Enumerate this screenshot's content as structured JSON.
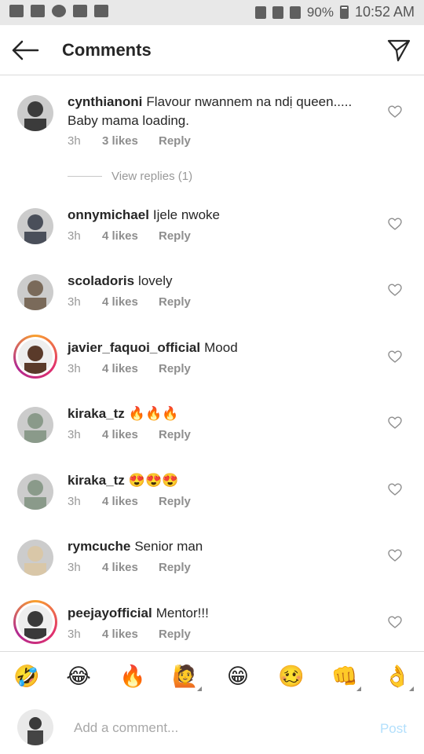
{
  "status_bar": {
    "battery": "90%",
    "time": "10:52 AM",
    "icons": [
      "gmail-icon",
      "message-icon",
      "whatsapp-icon",
      "gallery-icon",
      "email-icon",
      "alarm-icon",
      "wifi-icon",
      "signal-icon",
      "battery-icon"
    ]
  },
  "header": {
    "title": "Comments",
    "back_icon": "back-arrow-icon",
    "share_icon": "direct-send-icon"
  },
  "comments": [
    {
      "user": "cynthianoni",
      "text": "Flavour nwannem na ndị queen..... Baby mama loading.",
      "time": "3h",
      "likes": "3 likes",
      "reply": "Reply",
      "story_ring": false,
      "avatar_color": "#3b3b3b"
    },
    {
      "user": "onnymichael",
      "text": "Ijele nwoke",
      "time": "3h",
      "likes": "4 likes",
      "reply": "Reply",
      "story_ring": false,
      "avatar_color": "#4a4f5a"
    },
    {
      "user": "scoladoris",
      "text": "lovely",
      "time": "3h",
      "likes": "4 likes",
      "reply": "Reply",
      "story_ring": false,
      "avatar_color": "#7a6a5a"
    },
    {
      "user": "javier_faquoi_official",
      "text": "Mood",
      "time": "3h",
      "likes": "4 likes",
      "reply": "Reply",
      "story_ring": true,
      "avatar_color": "#5a3a2a"
    },
    {
      "user": "kiraka_tz",
      "text": "🔥🔥🔥",
      "time": "3h",
      "likes": "4 likes",
      "reply": "Reply",
      "story_ring": false,
      "avatar_color": "#8a9a8a"
    },
    {
      "user": "kiraka_tz",
      "text": "😍😍😍",
      "time": "3h",
      "likes": "4 likes",
      "reply": "Reply",
      "story_ring": false,
      "avatar_color": "#8a9a8a"
    },
    {
      "user": "rymcuche",
      "text": "Senior man",
      "time": "3h",
      "likes": "4 likes",
      "reply": "Reply",
      "story_ring": false,
      "avatar_color": "#d9c7a8"
    },
    {
      "user": "peejayofficial",
      "text": "Mentor!!!",
      "time": "3h",
      "likes": "4 likes",
      "reply": "Reply",
      "story_ring": true,
      "avatar_color": "#3a3a3a"
    }
  ],
  "view_replies": "View replies (1)",
  "emoji_bar": [
    "🤣",
    "😂",
    "🔥",
    "🙋",
    "😁",
    "🥴",
    "👊",
    "👌"
  ],
  "composer": {
    "placeholder": "Add a comment...",
    "post_label": "Post"
  },
  "colors": {
    "accent_post_disabled": "#b2dffc",
    "meta_gray": "#999999",
    "divider": "#dbdbdb"
  }
}
